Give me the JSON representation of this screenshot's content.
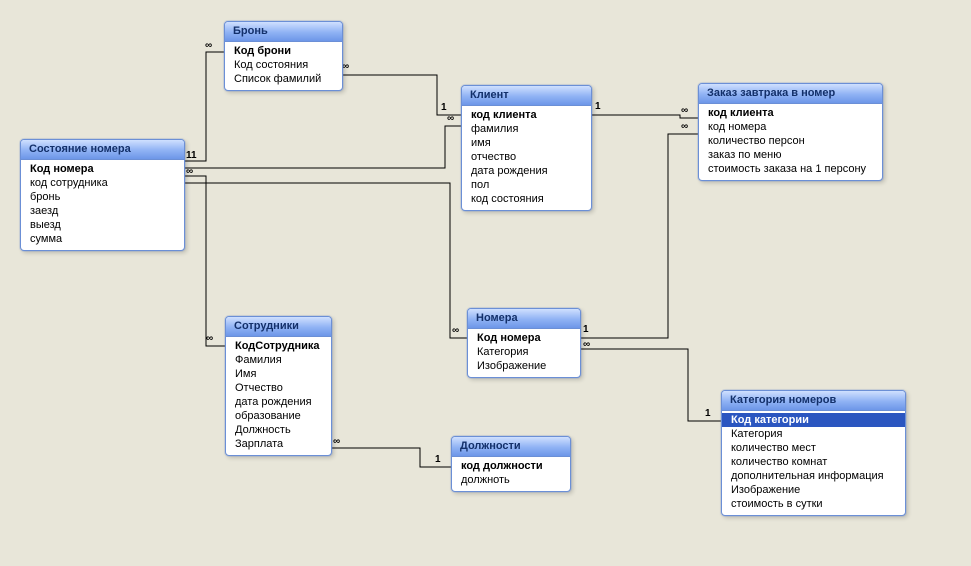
{
  "entities": {
    "roomState": {
      "title": "Состояние номера",
      "fields": [
        "Код номера",
        "код сотрудника",
        "бронь",
        "заезд",
        "выезд",
        "сумма"
      ]
    },
    "booking": {
      "title": "Бронь",
      "fields": [
        "Код брони",
        "Код состояния",
        "Список фамилий"
      ]
    },
    "client": {
      "title": "Клиент",
      "fields": [
        "код клиента",
        "фамилия",
        "имя",
        "отчество",
        "дата рождения",
        "пол",
        "код состояния"
      ]
    },
    "breakfast": {
      "title": "Заказ завтрака в номер",
      "fields": [
        "код клиента",
        "код номера",
        "количество персон",
        "заказ по меню",
        "стоимость заказа на 1 персону"
      ]
    },
    "employees": {
      "title": "Сотрудники",
      "fields": [
        "КодСотрудника",
        "Фамилия",
        "Имя",
        "Отчество",
        "дата рождения",
        "образование",
        "Должность",
        "Зарплата"
      ]
    },
    "rooms": {
      "title": "Номера",
      "fields": [
        "Код номера",
        "Категория",
        "Изображение"
      ]
    },
    "positions": {
      "title": "Должности",
      "fields": [
        "код должности",
        "должноть"
      ]
    },
    "category": {
      "title": "Категория номеров",
      "fields": [
        "Код категории",
        "Категория",
        "количество мест",
        "количество комнат",
        "дополнительная информация",
        "Изображение",
        "стоимость в сутки"
      ]
    }
  },
  "cards": [
    "11",
    "∞",
    "∞",
    "∞",
    "∞",
    "∞",
    "∞",
    "1",
    "1",
    "∞",
    "1",
    "∞",
    "∞",
    "1",
    "∞",
    "1"
  ]
}
